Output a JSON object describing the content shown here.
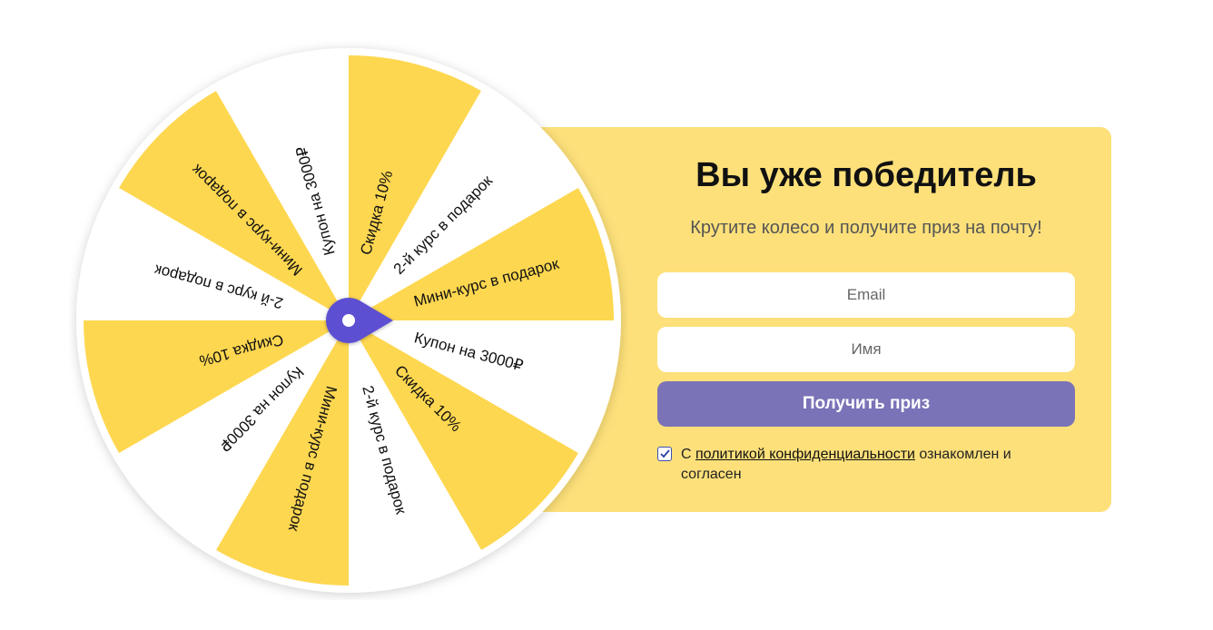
{
  "wheel": {
    "segments": [
      {
        "label": "Скидка 10%",
        "color": "#fed750"
      },
      {
        "label": "2-й курс в подарок",
        "color": "#ffffff"
      },
      {
        "label": "Мини-курс в подарок",
        "color": "#fed750"
      },
      {
        "label": "Купон на 3000₽",
        "color": "#ffffff"
      },
      {
        "label": "Скидка 10%",
        "color": "#fed750"
      },
      {
        "label": "2-й курс в подарок",
        "color": "#ffffff"
      },
      {
        "label": "Мини-курс в подарок",
        "color": "#fed750"
      },
      {
        "label": "Купон на 3000₽",
        "color": "#ffffff"
      },
      {
        "label": "Скидка 10%",
        "color": "#fed750"
      },
      {
        "label": "2-й курс в подарок",
        "color": "#ffffff"
      },
      {
        "label": "Мини-курс в подарок",
        "color": "#fed750"
      },
      {
        "label": "Купон на 3000₽",
        "color": "#ffffff"
      }
    ],
    "pointer_color": "#5b4fd2"
  },
  "panel": {
    "title": "Вы уже победитель",
    "subtitle": "Крутите колесо и получите приз на почту!",
    "email_placeholder": "Email",
    "name_placeholder": "Имя",
    "submit_label": "Получить приз",
    "consent_prefix": "С ",
    "consent_link": "политикой конфиденциальности",
    "consent_suffix": " ознакомлен и согласен",
    "consent_checked": true
  },
  "colors": {
    "panel_bg": "#fde07a",
    "button_bg": "#7a73b8",
    "segment_yellow": "#fed750",
    "segment_white": "#ffffff"
  }
}
